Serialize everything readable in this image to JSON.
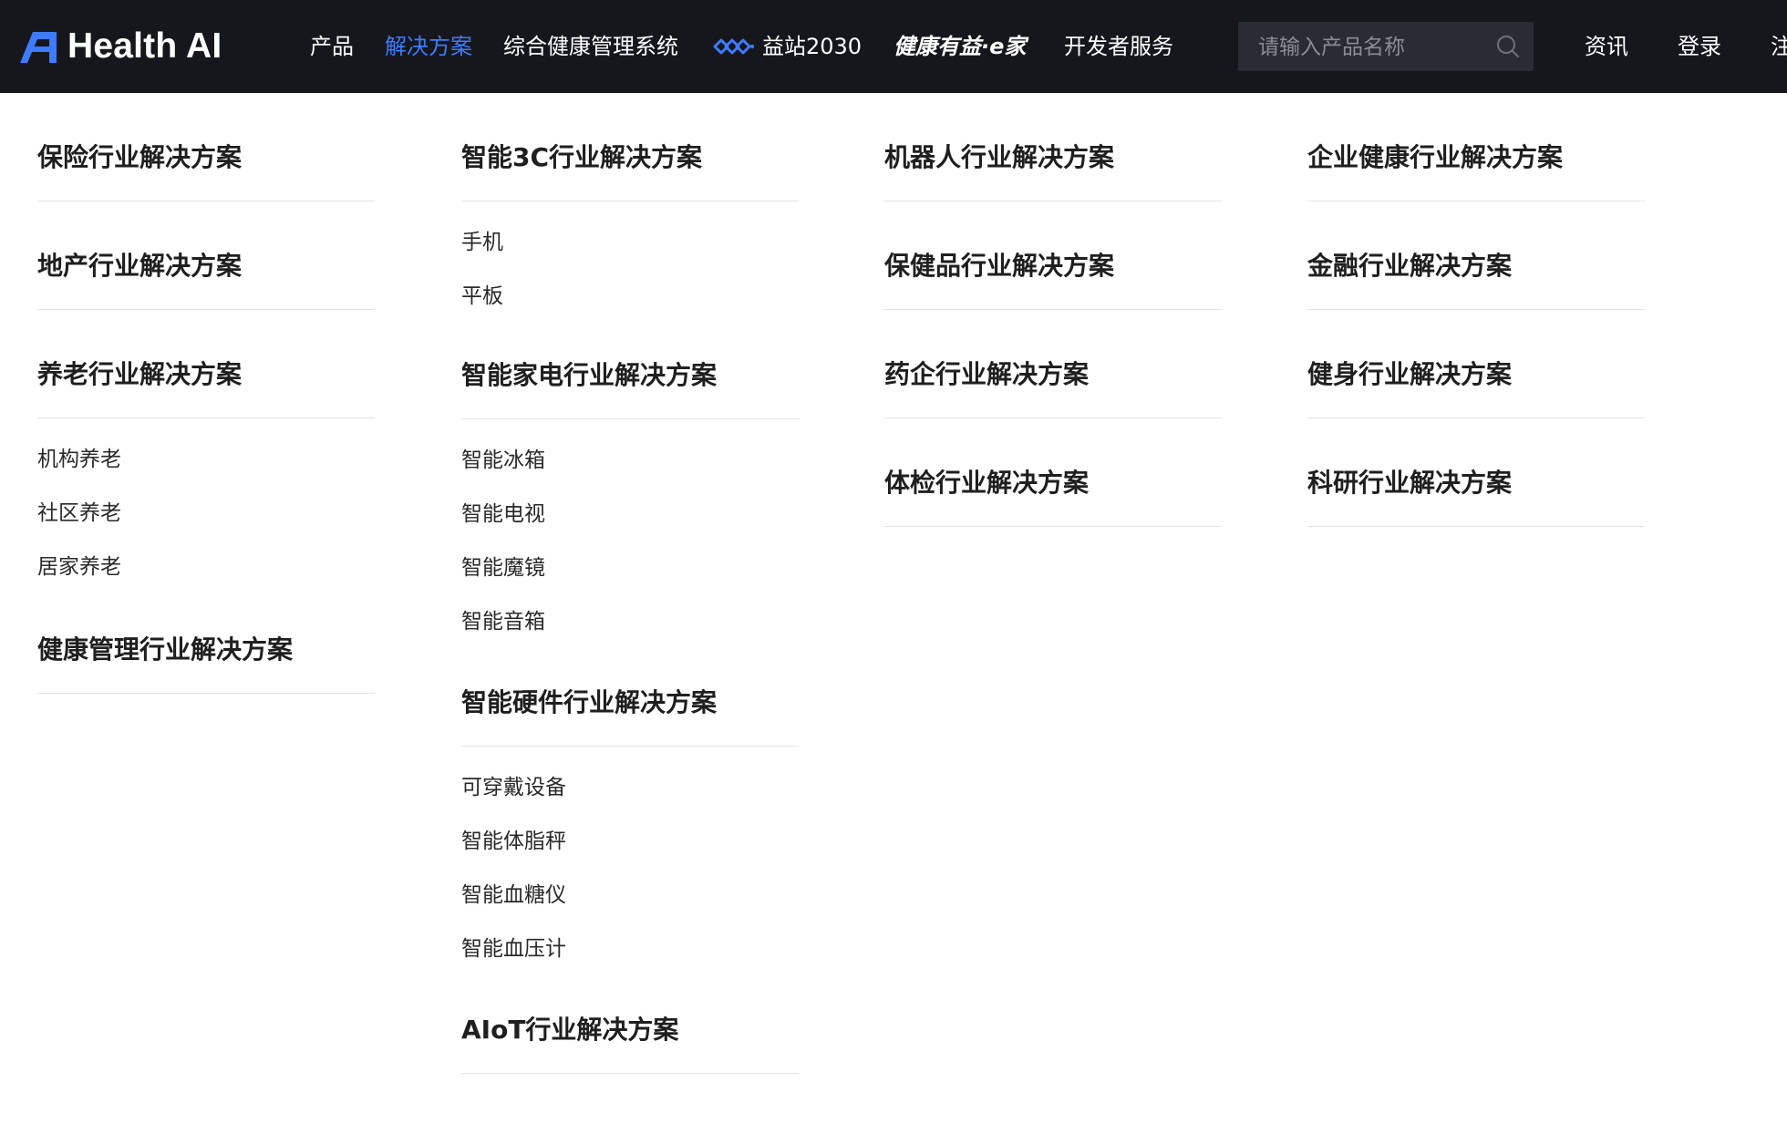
{
  "header": {
    "logo_text": "Health AI",
    "nav": [
      {
        "label": "产品"
      },
      {
        "label": "解决方案",
        "active": true
      },
      {
        "label": "综合健康管理系统"
      },
      {
        "label": "益站2030"
      },
      {
        "label": "健康有益·e家"
      },
      {
        "label": "开发者服务"
      }
    ],
    "search": {
      "placeholder": "请输入产品名称"
    },
    "right": {
      "news": "资讯",
      "login": "登录",
      "register_partial": "注"
    },
    "colors": {
      "bg": "#16171c",
      "accent": "#3d7bff",
      "search_bg": "#2a2c33"
    }
  },
  "menu": {
    "col1": [
      {
        "title": "保险行业解决方案",
        "items": []
      },
      {
        "title": "地产行业解决方案",
        "items": []
      },
      {
        "title": "养老行业解决方案",
        "items": [
          "机构养老",
          "社区养老",
          "居家养老"
        ]
      },
      {
        "title": "健康管理行业解决方案",
        "items": []
      }
    ],
    "col2": [
      {
        "title": "智能3C行业解决方案",
        "items": [
          "手机",
          "平板"
        ]
      },
      {
        "title": "智能家电行业解决方案",
        "items": [
          "智能冰箱",
          "智能电视",
          "智能魔镜",
          "智能音箱"
        ]
      },
      {
        "title": "智能硬件行业解决方案",
        "items": [
          "可穿戴设备",
          "智能体脂秤",
          "智能血糖仪",
          "智能血压计"
        ]
      },
      {
        "title": "AIoT行业解决方案",
        "items": []
      }
    ],
    "col3": [
      {
        "title": "机器人行业解决方案",
        "items": []
      },
      {
        "title": "保健品行业解决方案",
        "items": []
      },
      {
        "title": "药企行业解决方案",
        "items": []
      },
      {
        "title": "体检行业解决方案",
        "items": []
      }
    ],
    "col4": [
      {
        "title": "企业健康行业解决方案",
        "items": []
      },
      {
        "title": "金融行业解决方案",
        "items": []
      },
      {
        "title": "健身行业解决方案",
        "items": []
      },
      {
        "title": "科研行业解决方案",
        "items": []
      }
    ]
  }
}
